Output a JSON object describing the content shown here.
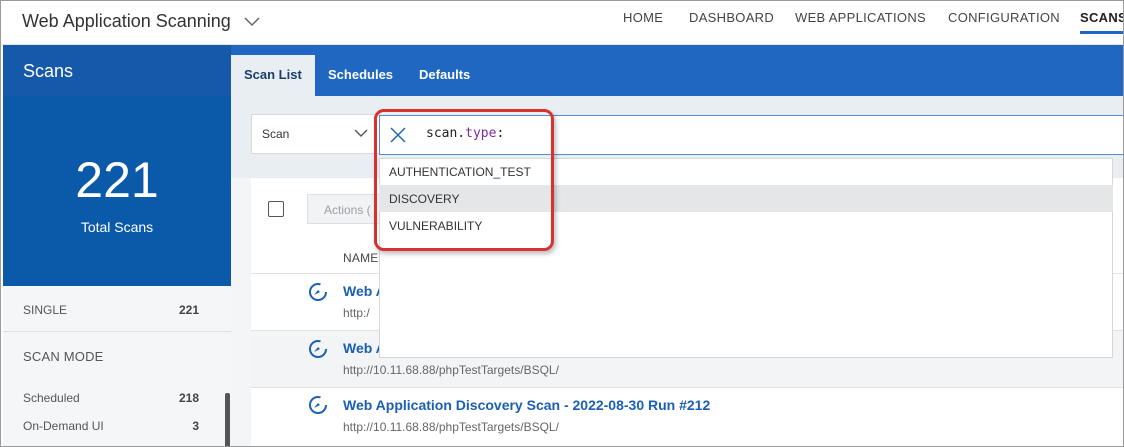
{
  "app": {
    "title": "Web Application Scanning"
  },
  "nav": {
    "items": [
      {
        "label": "HOME"
      },
      {
        "label": "DASHBOARD"
      },
      {
        "label": "WEB APPLICATIONS"
      },
      {
        "label": "CONFIGURATION"
      },
      {
        "label": "SCANS",
        "active": true
      }
    ]
  },
  "sidebar": {
    "title": "Scans",
    "total_count": "221",
    "total_label": "Total Scans",
    "single_label": "SINGLE",
    "single_count": "221",
    "section_title": "SCAN MODE",
    "modes": [
      {
        "label": "Scheduled",
        "count": "218"
      },
      {
        "label": "On-Demand UI",
        "count": "3"
      }
    ]
  },
  "tabs": [
    {
      "label": "Scan List",
      "active": true
    },
    {
      "label": "Schedules"
    },
    {
      "label": "Defaults"
    }
  ],
  "search": {
    "scope_value": "Scan",
    "query_prefix": "scan.",
    "query_property": "type",
    "query_suffix": ":",
    "suggestions": [
      {
        "label": "AUTHENTICATION_TEST"
      },
      {
        "label": "DISCOVERY",
        "highlighted": true
      },
      {
        "label": "VULNERABILITY"
      }
    ]
  },
  "list": {
    "actions_label": "Actions (",
    "column_name": "NAME",
    "rows": [
      {
        "name": "Web A",
        "url": "http:/"
      },
      {
        "name": "Web A",
        "url": "http://10.11.68.88/phpTestTargets/BSQL/"
      },
      {
        "name": "Web Application Discovery Scan - 2022-08-30 Run #212",
        "url": "http://10.11.68.88/phpTestTargets/BSQL/"
      }
    ]
  },
  "colors": {
    "brand_blue": "#1f67c0",
    "sidebar_dark_blue": "#0b5aaa",
    "link_blue": "#1a5fb4",
    "callout_red": "#d7322f"
  }
}
